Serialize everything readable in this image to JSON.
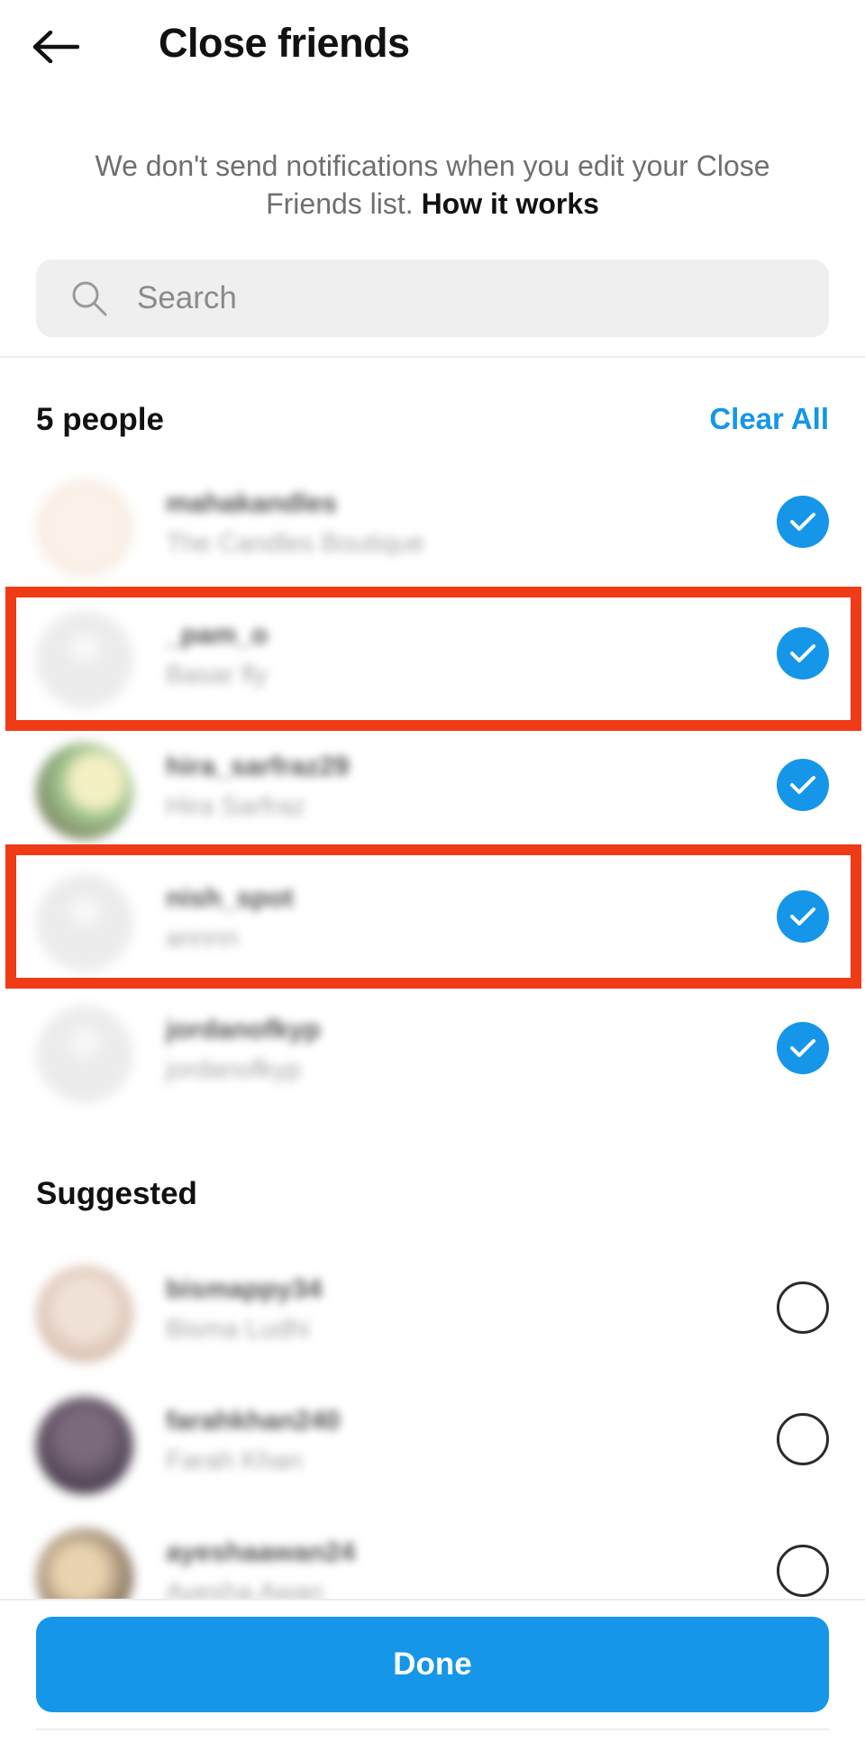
{
  "header": {
    "title": "Close friends",
    "back_icon": "arrow-left-icon"
  },
  "notice": {
    "text": "We don't send notifications when you edit your Close Friends list.",
    "link": "How it works"
  },
  "search": {
    "placeholder": "Search",
    "icon": "search-icon"
  },
  "close_friends": {
    "count_label": "5 people",
    "clear_all": "Clear All",
    "items": [
      {
        "username": "mahakandles",
        "full_name": "The Candles Boutique",
        "selected": true,
        "highlighted": false
      },
      {
        "username": "_pam_o",
        "full_name": "Basar fly",
        "selected": true,
        "highlighted": true
      },
      {
        "username": "hira_sarfraz29",
        "full_name": "Hira Sarfraz",
        "selected": true,
        "highlighted": false
      },
      {
        "username": "nish_spot",
        "full_name": "annnn",
        "selected": true,
        "highlighted": true
      },
      {
        "username": "jordanofkyp",
        "full_name": "jordanofkyp",
        "selected": true,
        "highlighted": false
      }
    ]
  },
  "suggested": {
    "label": "Suggested",
    "items": [
      {
        "username": "bismappy34",
        "full_name": "Bisma Ludhi",
        "selected": false
      },
      {
        "username": "farahkhan240",
        "full_name": "Farah Khan",
        "selected": false
      },
      {
        "username": "ayeshaawan24",
        "full_name": "Ayesha Awan",
        "selected": false
      }
    ]
  },
  "footer": {
    "done_label": "Done"
  },
  "colors": {
    "accent": "#1596e8",
    "highlight": "#f03b17",
    "text": "#111111",
    "muted": "#6f6f6f"
  }
}
